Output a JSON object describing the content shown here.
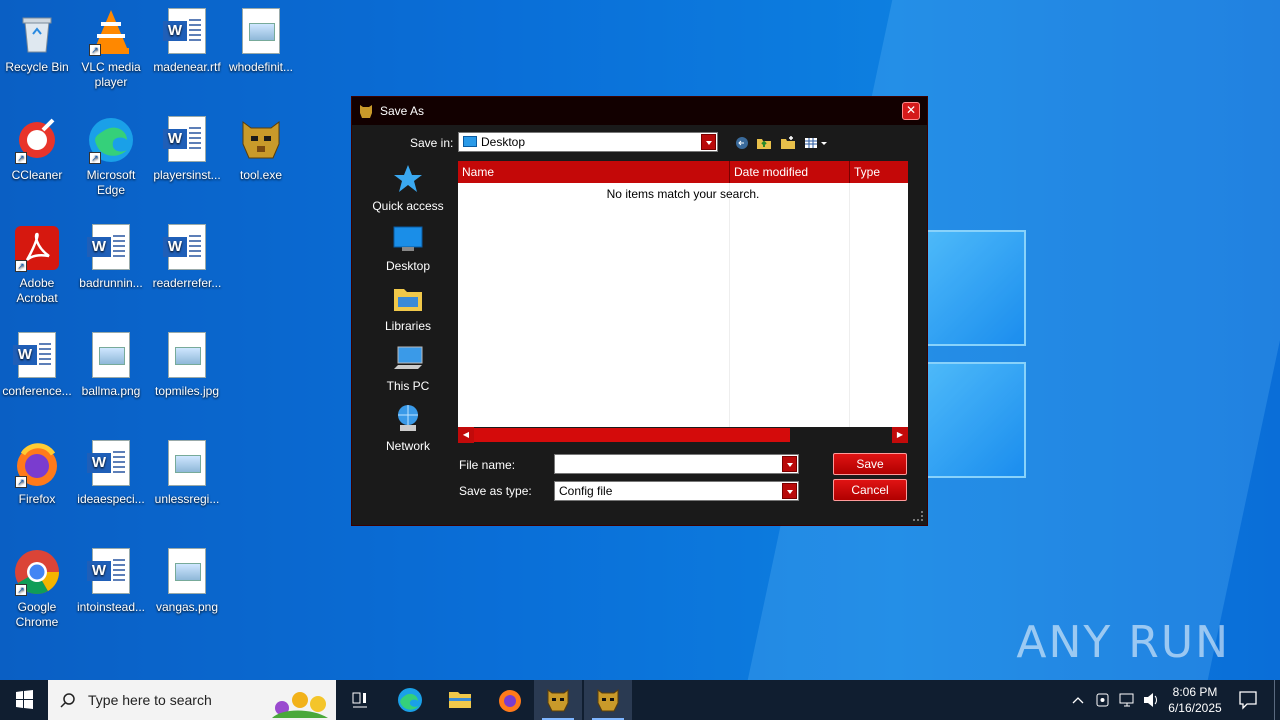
{
  "desktop": {
    "icons": [
      {
        "label": "Recycle Bin",
        "icon": "recycle-bin-icon"
      },
      {
        "label": "VLC media player",
        "icon": "vlc-icon"
      },
      {
        "label": "madenear.rtf",
        "icon": "word-doc-icon"
      },
      {
        "label": "whodefinit...",
        "icon": "image-file-icon"
      },
      {
        "label": "CCleaner",
        "icon": "ccleaner-icon"
      },
      {
        "label": "Microsoft Edge",
        "icon": "edge-icon"
      },
      {
        "label": "playersinst...",
        "icon": "word-doc-icon"
      },
      {
        "label": "tool.exe",
        "icon": "tool-exe-icon"
      },
      {
        "label": "Adobe Acrobat",
        "icon": "acrobat-icon"
      },
      {
        "label": "badrunnin...",
        "icon": "word-doc-icon"
      },
      {
        "label": "readerrefer...",
        "icon": "word-doc-icon"
      },
      {
        "label": "conference...",
        "icon": "word-doc-icon"
      },
      {
        "label": "ballma.png",
        "icon": "image-file-icon"
      },
      {
        "label": "topmiles.jpg",
        "icon": "image-file-icon"
      },
      {
        "label": "Firefox",
        "icon": "firefox-icon"
      },
      {
        "label": "ideaespeci...",
        "icon": "word-doc-icon"
      },
      {
        "label": "unlessregi...",
        "icon": "image-file-icon"
      },
      {
        "label": "Google Chrome",
        "icon": "chrome-icon"
      },
      {
        "label": "intoinstead...",
        "icon": "word-doc-icon"
      },
      {
        "label": "vangas.png",
        "icon": "image-file-icon"
      }
    ],
    "watermark": "ANY RUN"
  },
  "dialog": {
    "title": "Save As",
    "save_in_label": "Save in:",
    "save_in_value": "Desktop",
    "places": [
      {
        "label": "Quick access",
        "icon": "star-icon"
      },
      {
        "label": "Desktop",
        "icon": "desktop-icon"
      },
      {
        "label": "Libraries",
        "icon": "folder-icon"
      },
      {
        "label": "This PC",
        "icon": "computer-icon"
      },
      {
        "label": "Network",
        "icon": "network-icon"
      }
    ],
    "columns": [
      "Name",
      "Date modified",
      "Type"
    ],
    "empty_message": "No items match your search.",
    "file_name_label": "File name:",
    "file_name_value": "",
    "save_as_type_label": "Save as type:",
    "save_as_type_value": "Config file",
    "save_button": "Save",
    "cancel_button": "Cancel",
    "accent_color": "#c40808"
  },
  "taskbar": {
    "search_placeholder": "Type here to search",
    "apps": [
      "task-view-icon",
      "edge-icon",
      "file-explorer-icon",
      "firefox-icon",
      "tool-exe-icon",
      "tool-exe-icon"
    ],
    "time": "8:06 PM",
    "date": "6/16/2025"
  }
}
